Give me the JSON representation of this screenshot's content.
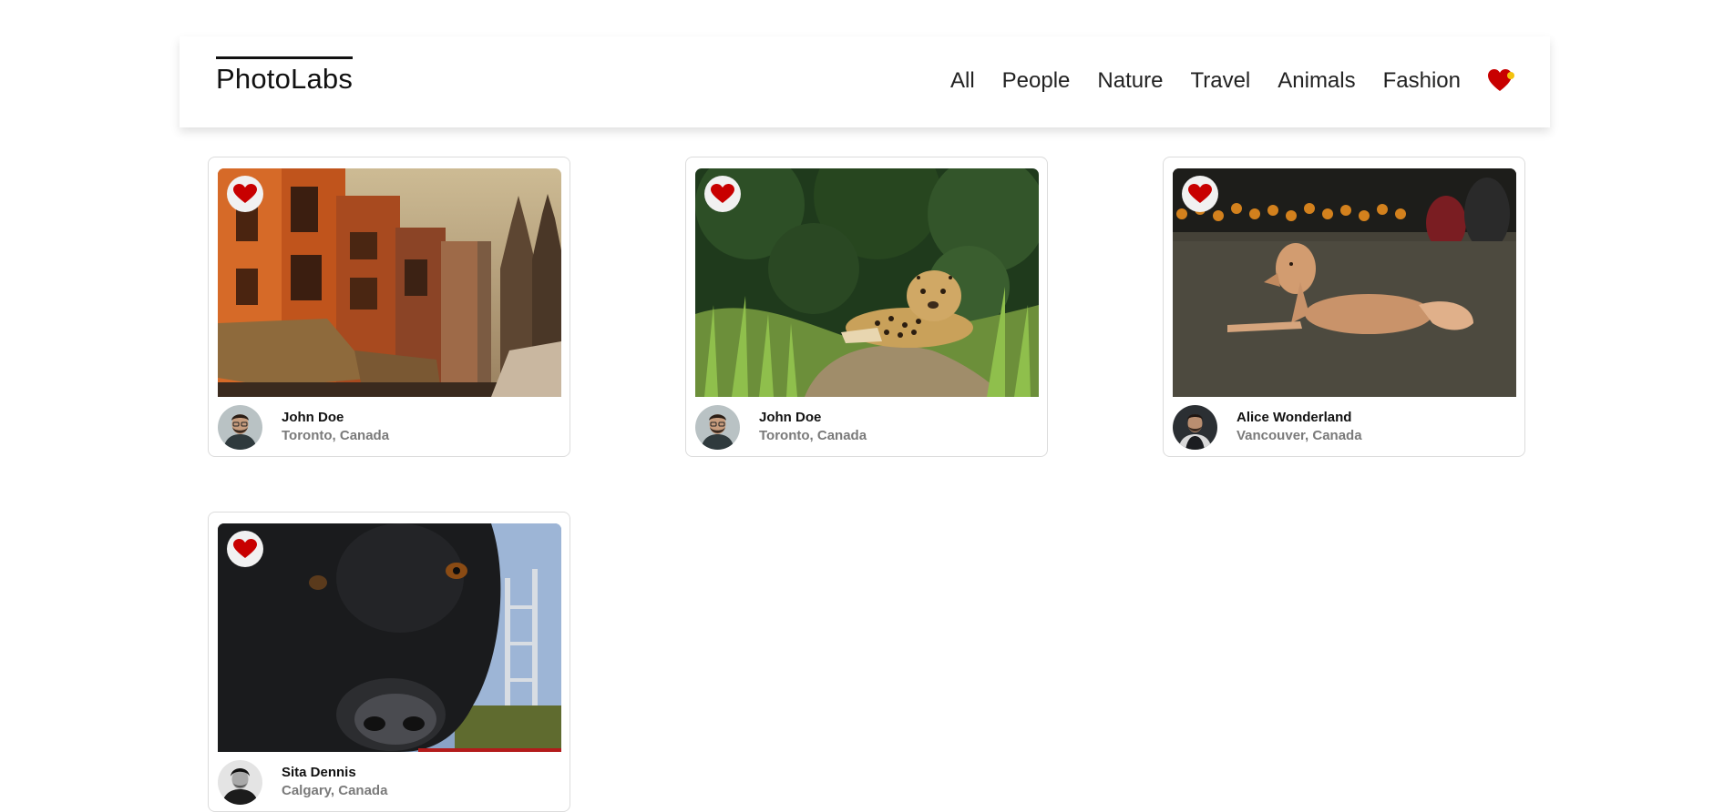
{
  "app": {
    "logo": "PhotoLabs",
    "topics": [
      "All",
      "People",
      "Nature",
      "Travel",
      "Animals",
      "Fashion"
    ],
    "fav_badge_icon": "heart-badge-icon",
    "accent_color": "#c80000"
  },
  "photos": [
    {
      "scene": "street-buildings",
      "favourited": true,
      "user": {
        "name": "John Doe",
        "location": "Toronto, Canada",
        "avatar": "man-glasses-beard"
      }
    },
    {
      "scene": "jaguar-grass",
      "favourited": true,
      "user": {
        "name": "John Doe",
        "location": "Toronto, Canada",
        "avatar": "man-glasses-beard"
      }
    },
    {
      "scene": "dog-lawn",
      "favourited": true,
      "user": {
        "name": "Alice Wonderland",
        "location": "Vancouver, Canada",
        "avatar": "man-suit-dark"
      }
    },
    {
      "scene": "black-dog-closeup",
      "favourited": true,
      "user": {
        "name": "Sita Dennis",
        "location": "Calgary, Canada",
        "avatar": "man-bw"
      }
    }
  ]
}
